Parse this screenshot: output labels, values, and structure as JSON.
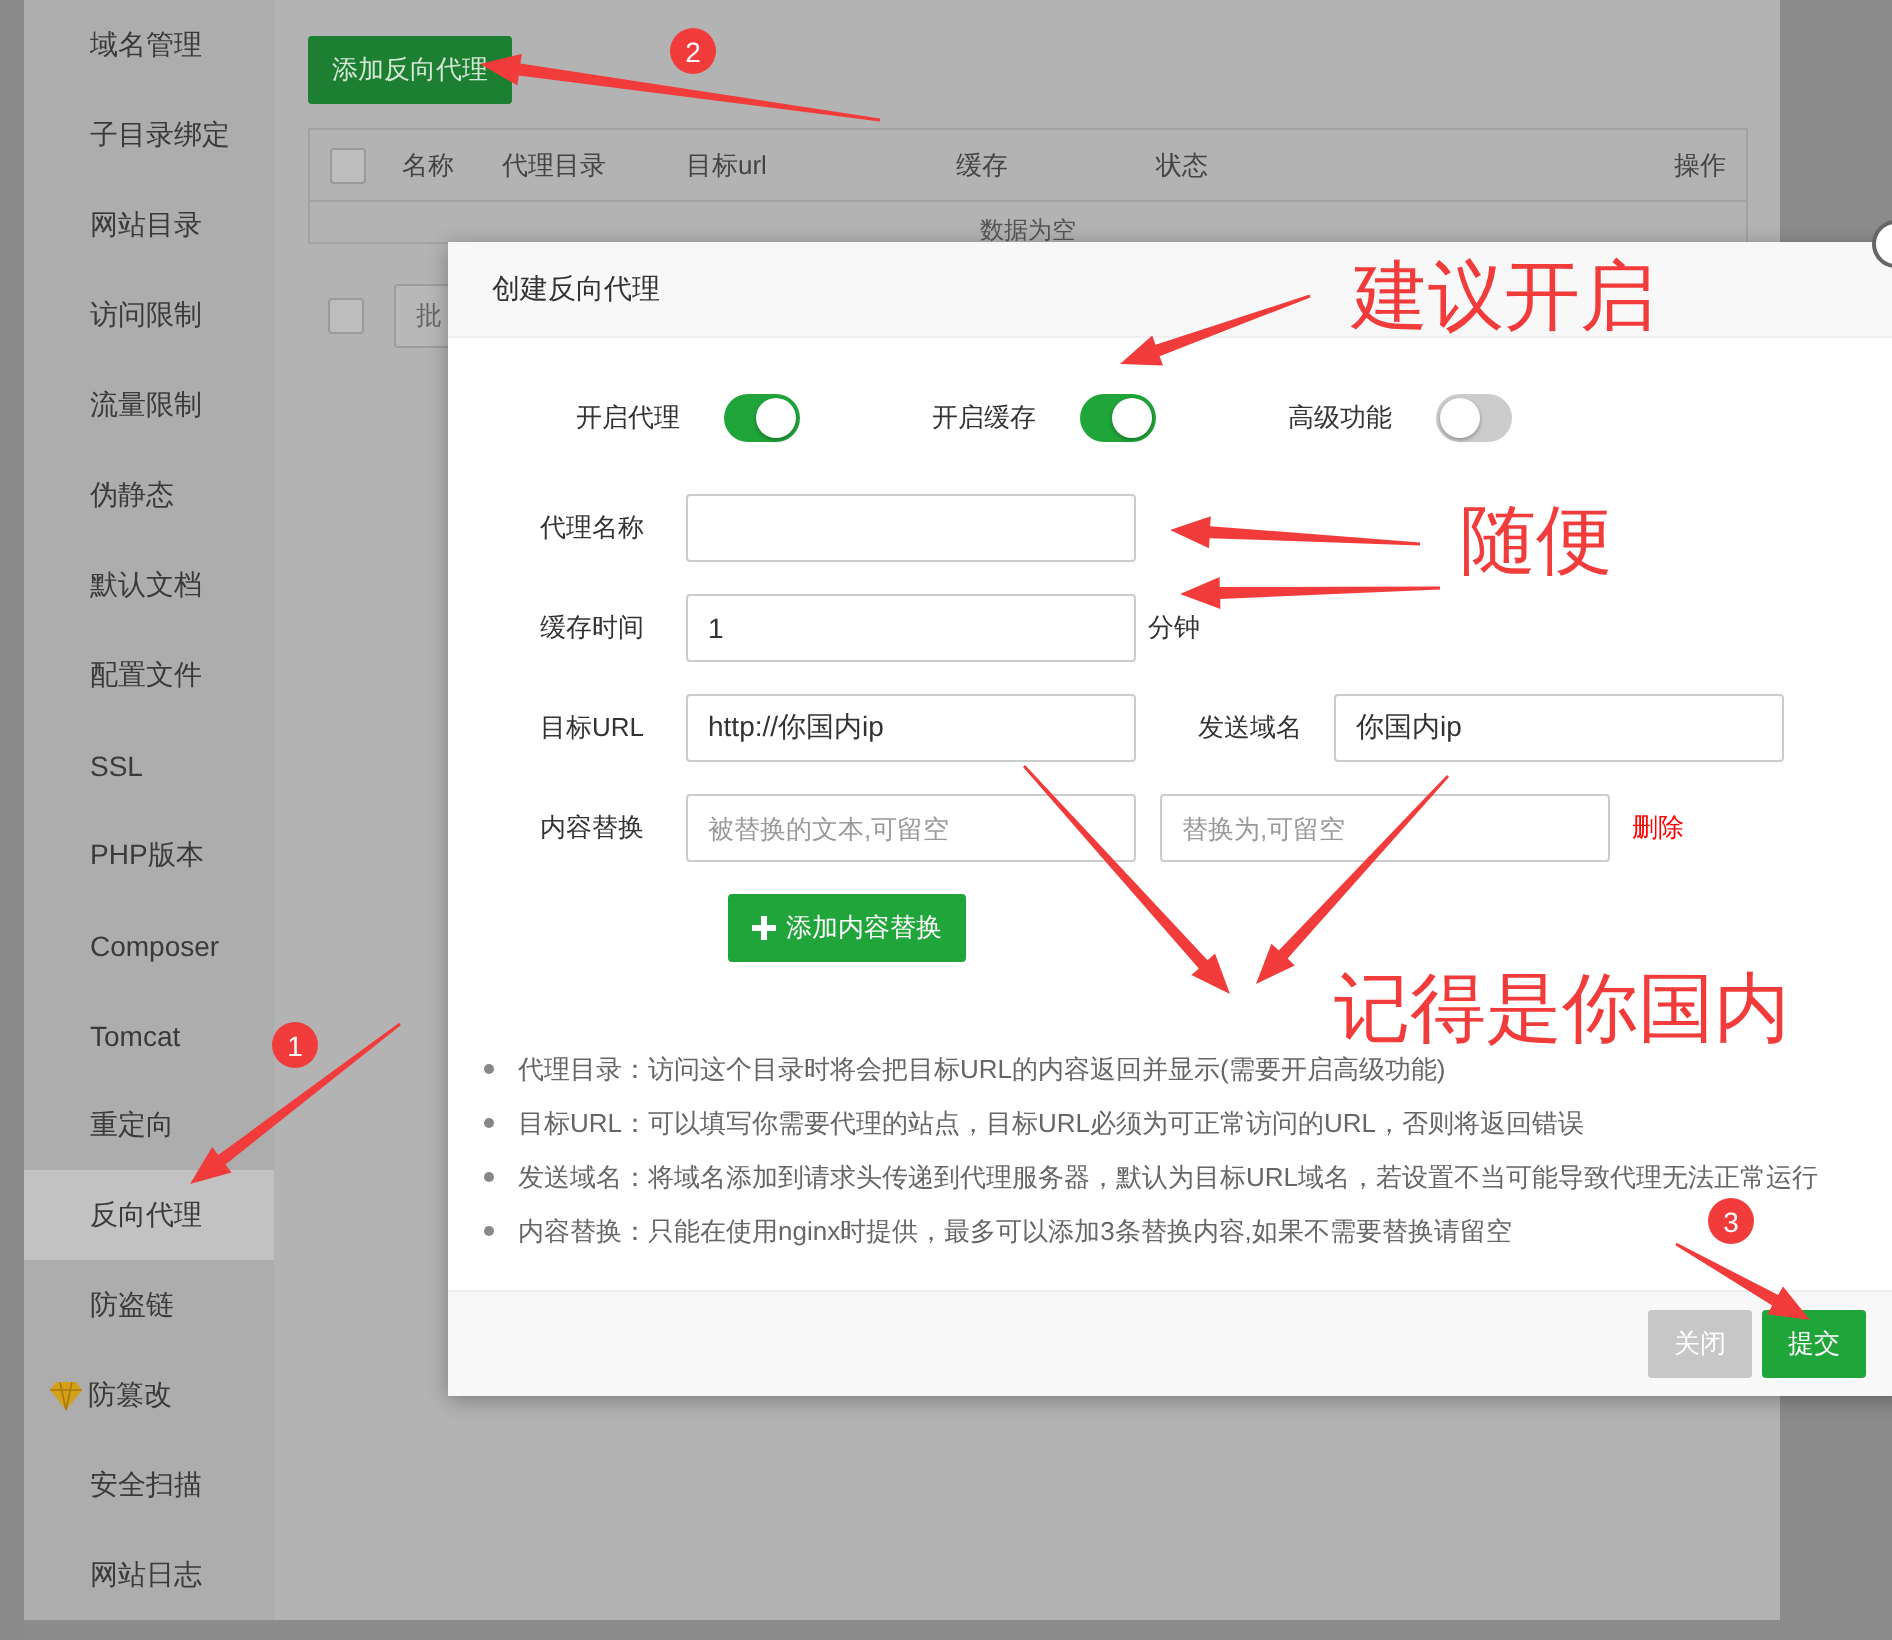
{
  "sidebar": {
    "items": [
      {
        "label": "域名管理",
        "selected": false,
        "kind": "plain"
      },
      {
        "label": "子目录绑定",
        "selected": false,
        "kind": "plain"
      },
      {
        "label": "网站目录",
        "selected": false,
        "kind": "plain"
      },
      {
        "label": "访问限制",
        "selected": false,
        "kind": "plain"
      },
      {
        "label": "流量限制",
        "selected": false,
        "kind": "plain"
      },
      {
        "label": "伪静态",
        "selected": false,
        "kind": "plain"
      },
      {
        "label": "默认文档",
        "selected": false,
        "kind": "plain"
      },
      {
        "label": "配置文件",
        "selected": false,
        "kind": "plain"
      },
      {
        "label": "SSL",
        "selected": false,
        "kind": "plain"
      },
      {
        "label": "PHP版本",
        "selected": false,
        "kind": "plain"
      },
      {
        "label": "Composer",
        "selected": false,
        "kind": "plain"
      },
      {
        "label": "Tomcat",
        "selected": false,
        "kind": "plain"
      },
      {
        "label": "重定向",
        "selected": false,
        "kind": "plain"
      },
      {
        "label": "反向代理",
        "selected": true,
        "kind": "plain"
      },
      {
        "label": "防盗链",
        "selected": false,
        "kind": "plain"
      },
      {
        "label": "防篡改",
        "selected": false,
        "kind": "gem"
      },
      {
        "label": "安全扫描",
        "selected": false,
        "kind": "plain"
      },
      {
        "label": "网站日志",
        "selected": false,
        "kind": "plain"
      }
    ]
  },
  "content": {
    "add_button": "添加反向代理",
    "table": {
      "header_checkbox": {
        "checked": false
      },
      "columns": [
        "名称",
        "代理目录",
        "目标url",
        "缓存",
        "状态",
        "操作"
      ],
      "empty_text": "数据为空"
    },
    "footer_checkbox": {
      "checked": false
    },
    "batch_select": "批"
  },
  "dialog": {
    "title": "创建反向代理",
    "toggles": [
      {
        "label": "开启代理",
        "on": true
      },
      {
        "label": "开启缓存",
        "on": true
      },
      {
        "label": "高级功能",
        "on": false
      }
    ],
    "name_label": "代理名称",
    "cache_label": "缓存时间",
    "cache_value": "1",
    "cache_unit": "分钟",
    "url_label": "目标URL",
    "url_value": "http://你国内ip",
    "domain_label": "发送域名",
    "domain_value": "你国内ip",
    "replace_label": "内容替换",
    "replace_from_placeholder": "被替换的文本,可留空",
    "replace_to_placeholder": "替换为,可留空",
    "delete_link": "删除",
    "add_replace_button": "添加内容替换",
    "notes": [
      "代理目录：访问这个目录时将会把目标URL的内容返回并显示(需要开启高级功能)",
      "目标URL：可以填写你需要代理的站点，目标URL必须为可正常访问的URL，否则将返回错误",
      "发送域名：将域名添加到请求头传递到代理服务器，默认为目标URL域名，若设置不当可能导致代理无法正常运行",
      "内容替换：只能在使用nginx时提供，最多可以添加3条替换内容,如果不需要替换请留空"
    ],
    "buttons": [
      {
        "label": "关闭",
        "kind": "secondary"
      },
      {
        "label": "提交",
        "kind": "primary"
      }
    ]
  },
  "annotations": {
    "texts": [
      "建议开启",
      "随便",
      "记得是你国内"
    ],
    "badges": [
      "1",
      "2",
      "3"
    ]
  }
}
